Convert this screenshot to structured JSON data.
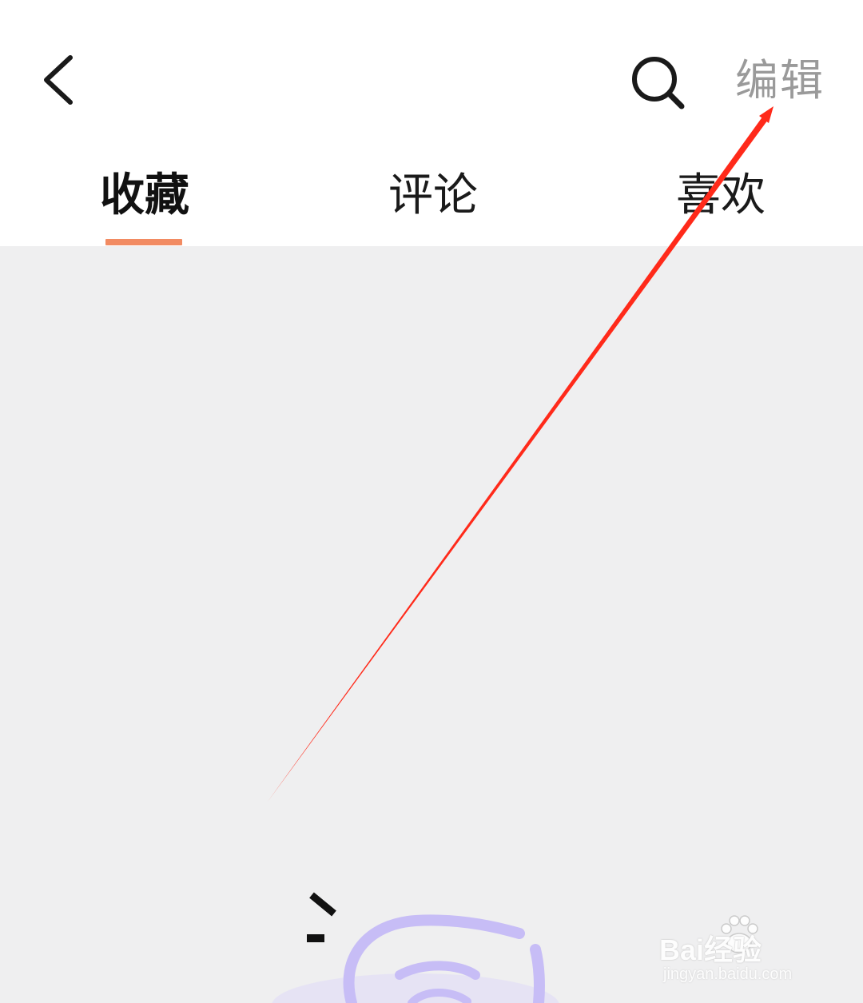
{
  "header": {
    "back_icon": "chevron-left-icon",
    "search_icon": "search-icon",
    "edit_label": "编辑"
  },
  "tabs": [
    {
      "label": "收藏",
      "active": true
    },
    {
      "label": "评论",
      "active": false
    },
    {
      "label": "喜欢",
      "active": false
    }
  ],
  "colors": {
    "tab_indicator": "#f28b62",
    "content_background": "#efeff0",
    "edit_text": "#9a9a9a",
    "annotation_arrow": "#ff2a1a",
    "illustration_stroke": "#c7bdf6"
  },
  "annotation": {
    "type": "arrow",
    "points_to": "edit-button"
  },
  "watermark": {
    "logo_text": "Bai经验",
    "sub_text": "jingyan.baidu.com"
  }
}
